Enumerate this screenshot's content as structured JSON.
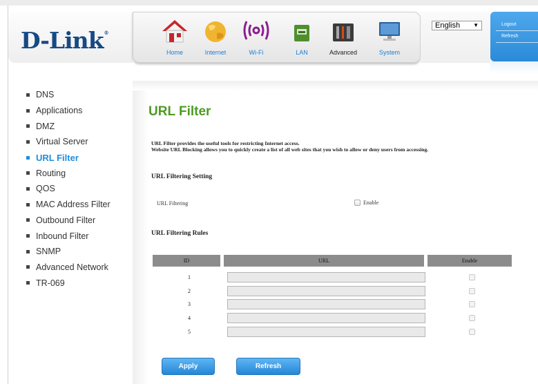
{
  "brand": {
    "logo": "D-Link",
    "registered": "®"
  },
  "nav": [
    {
      "label": "Home",
      "icon": "home-icon"
    },
    {
      "label": "Internet",
      "icon": "globe-icon"
    },
    {
      "label": "Wi-Fi",
      "icon": "wifi-icon"
    },
    {
      "label": "LAN",
      "icon": "lan-icon"
    },
    {
      "label": "Advanced",
      "icon": "tools-icon"
    },
    {
      "label": "System",
      "icon": "monitor-icon"
    }
  ],
  "language": {
    "selected": "English"
  },
  "session": {
    "logout": "Logout",
    "refresh": "Refresh"
  },
  "menu": [
    {
      "label": "DNS"
    },
    {
      "label": "Applications"
    },
    {
      "label": "DMZ"
    },
    {
      "label": "Virtual Server"
    },
    {
      "label": "URL Filter",
      "active": true
    },
    {
      "label": "Routing"
    },
    {
      "label": "QOS"
    },
    {
      "label": "MAC Address Filter"
    },
    {
      "label": "Outbound Filter"
    },
    {
      "label": "Inbound Filter"
    },
    {
      "label": "SNMP"
    },
    {
      "label": "Advanced Network"
    },
    {
      "label": "TR-069"
    }
  ],
  "page": {
    "title": "URL Filter",
    "description_1": "URL Filter provides the useful tools for restricting Internet access.",
    "description_2": "Website URL Blocking allows you to quickly create a list of all web sites that you wish to allow or deny users from accessing."
  },
  "setting": {
    "heading": "URL Filtering Setting",
    "field_label": "URL Filtering",
    "enable_label": "Enable",
    "enabled": false
  },
  "rules": {
    "heading": "URL Filtering Rules",
    "columns": [
      "ID",
      "URL",
      "Enable"
    ],
    "rows": [
      {
        "id": "1",
        "url": "",
        "enabled": false
      },
      {
        "id": "2",
        "url": "",
        "enabled": false
      },
      {
        "id": "3",
        "url": "",
        "enabled": false
      },
      {
        "id": "4",
        "url": "",
        "enabled": false
      },
      {
        "id": "5",
        "url": "",
        "enabled": false
      }
    ]
  },
  "actions": {
    "apply": "Apply",
    "refresh": "Refresh"
  },
  "colors": {
    "accent_blue": "#1f8ddb",
    "title_green": "#4d9b23",
    "logo_blue": "#174a84",
    "header_gray": "#8c8c8c"
  }
}
